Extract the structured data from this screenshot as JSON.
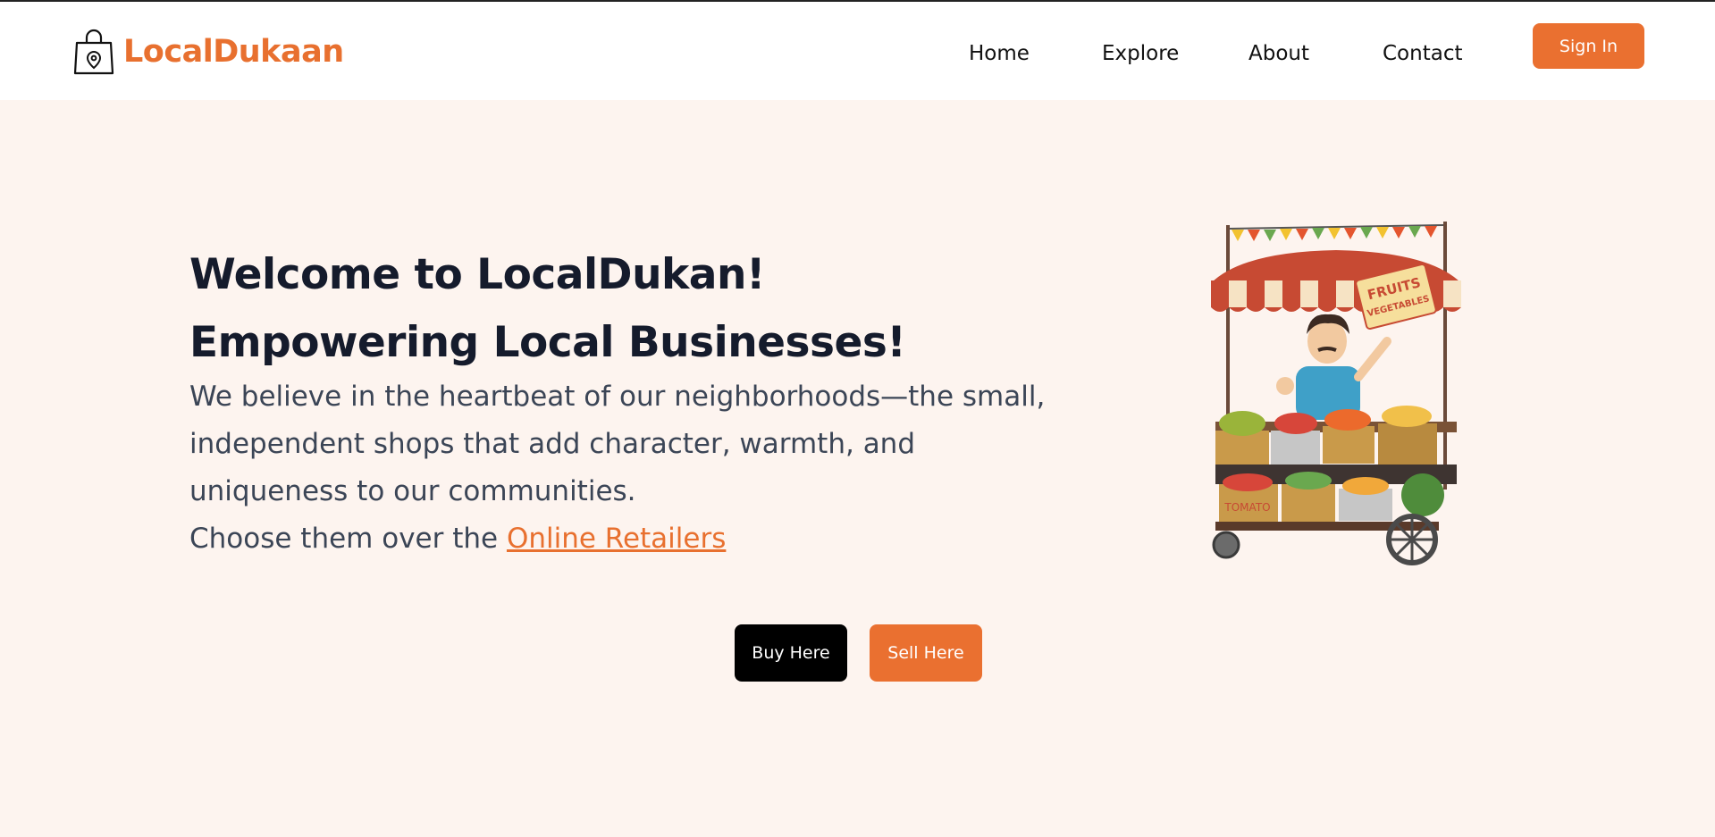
{
  "header": {
    "brand": "LocalDukaan",
    "nav": [
      "Home",
      "Explore",
      "About",
      "Contact"
    ],
    "signin_label": "Sign In"
  },
  "hero": {
    "heading_line1": "Welcome to LocalDukan!",
    "heading_line2": "Empowering Local Businesses!",
    "paragraph": "We believe in the heartbeat of our neighborhoods—the small, independent shops that add character, warmth, and uniqueness to our communities.",
    "choose_prefix": "Choose them over the ",
    "choose_link": "Online Retailers",
    "buy_label": "Buy Here",
    "sell_label": "Sell Here"
  },
  "illustration": {
    "sign_line1": "FRUITS",
    "sign_line2": "VEGETABLES",
    "crate_label": "TOMATO"
  },
  "colors": {
    "accent": "#ea7030",
    "page_bg": "#fdf4ef",
    "heading": "#151b2c",
    "body_text": "#3b4556"
  }
}
